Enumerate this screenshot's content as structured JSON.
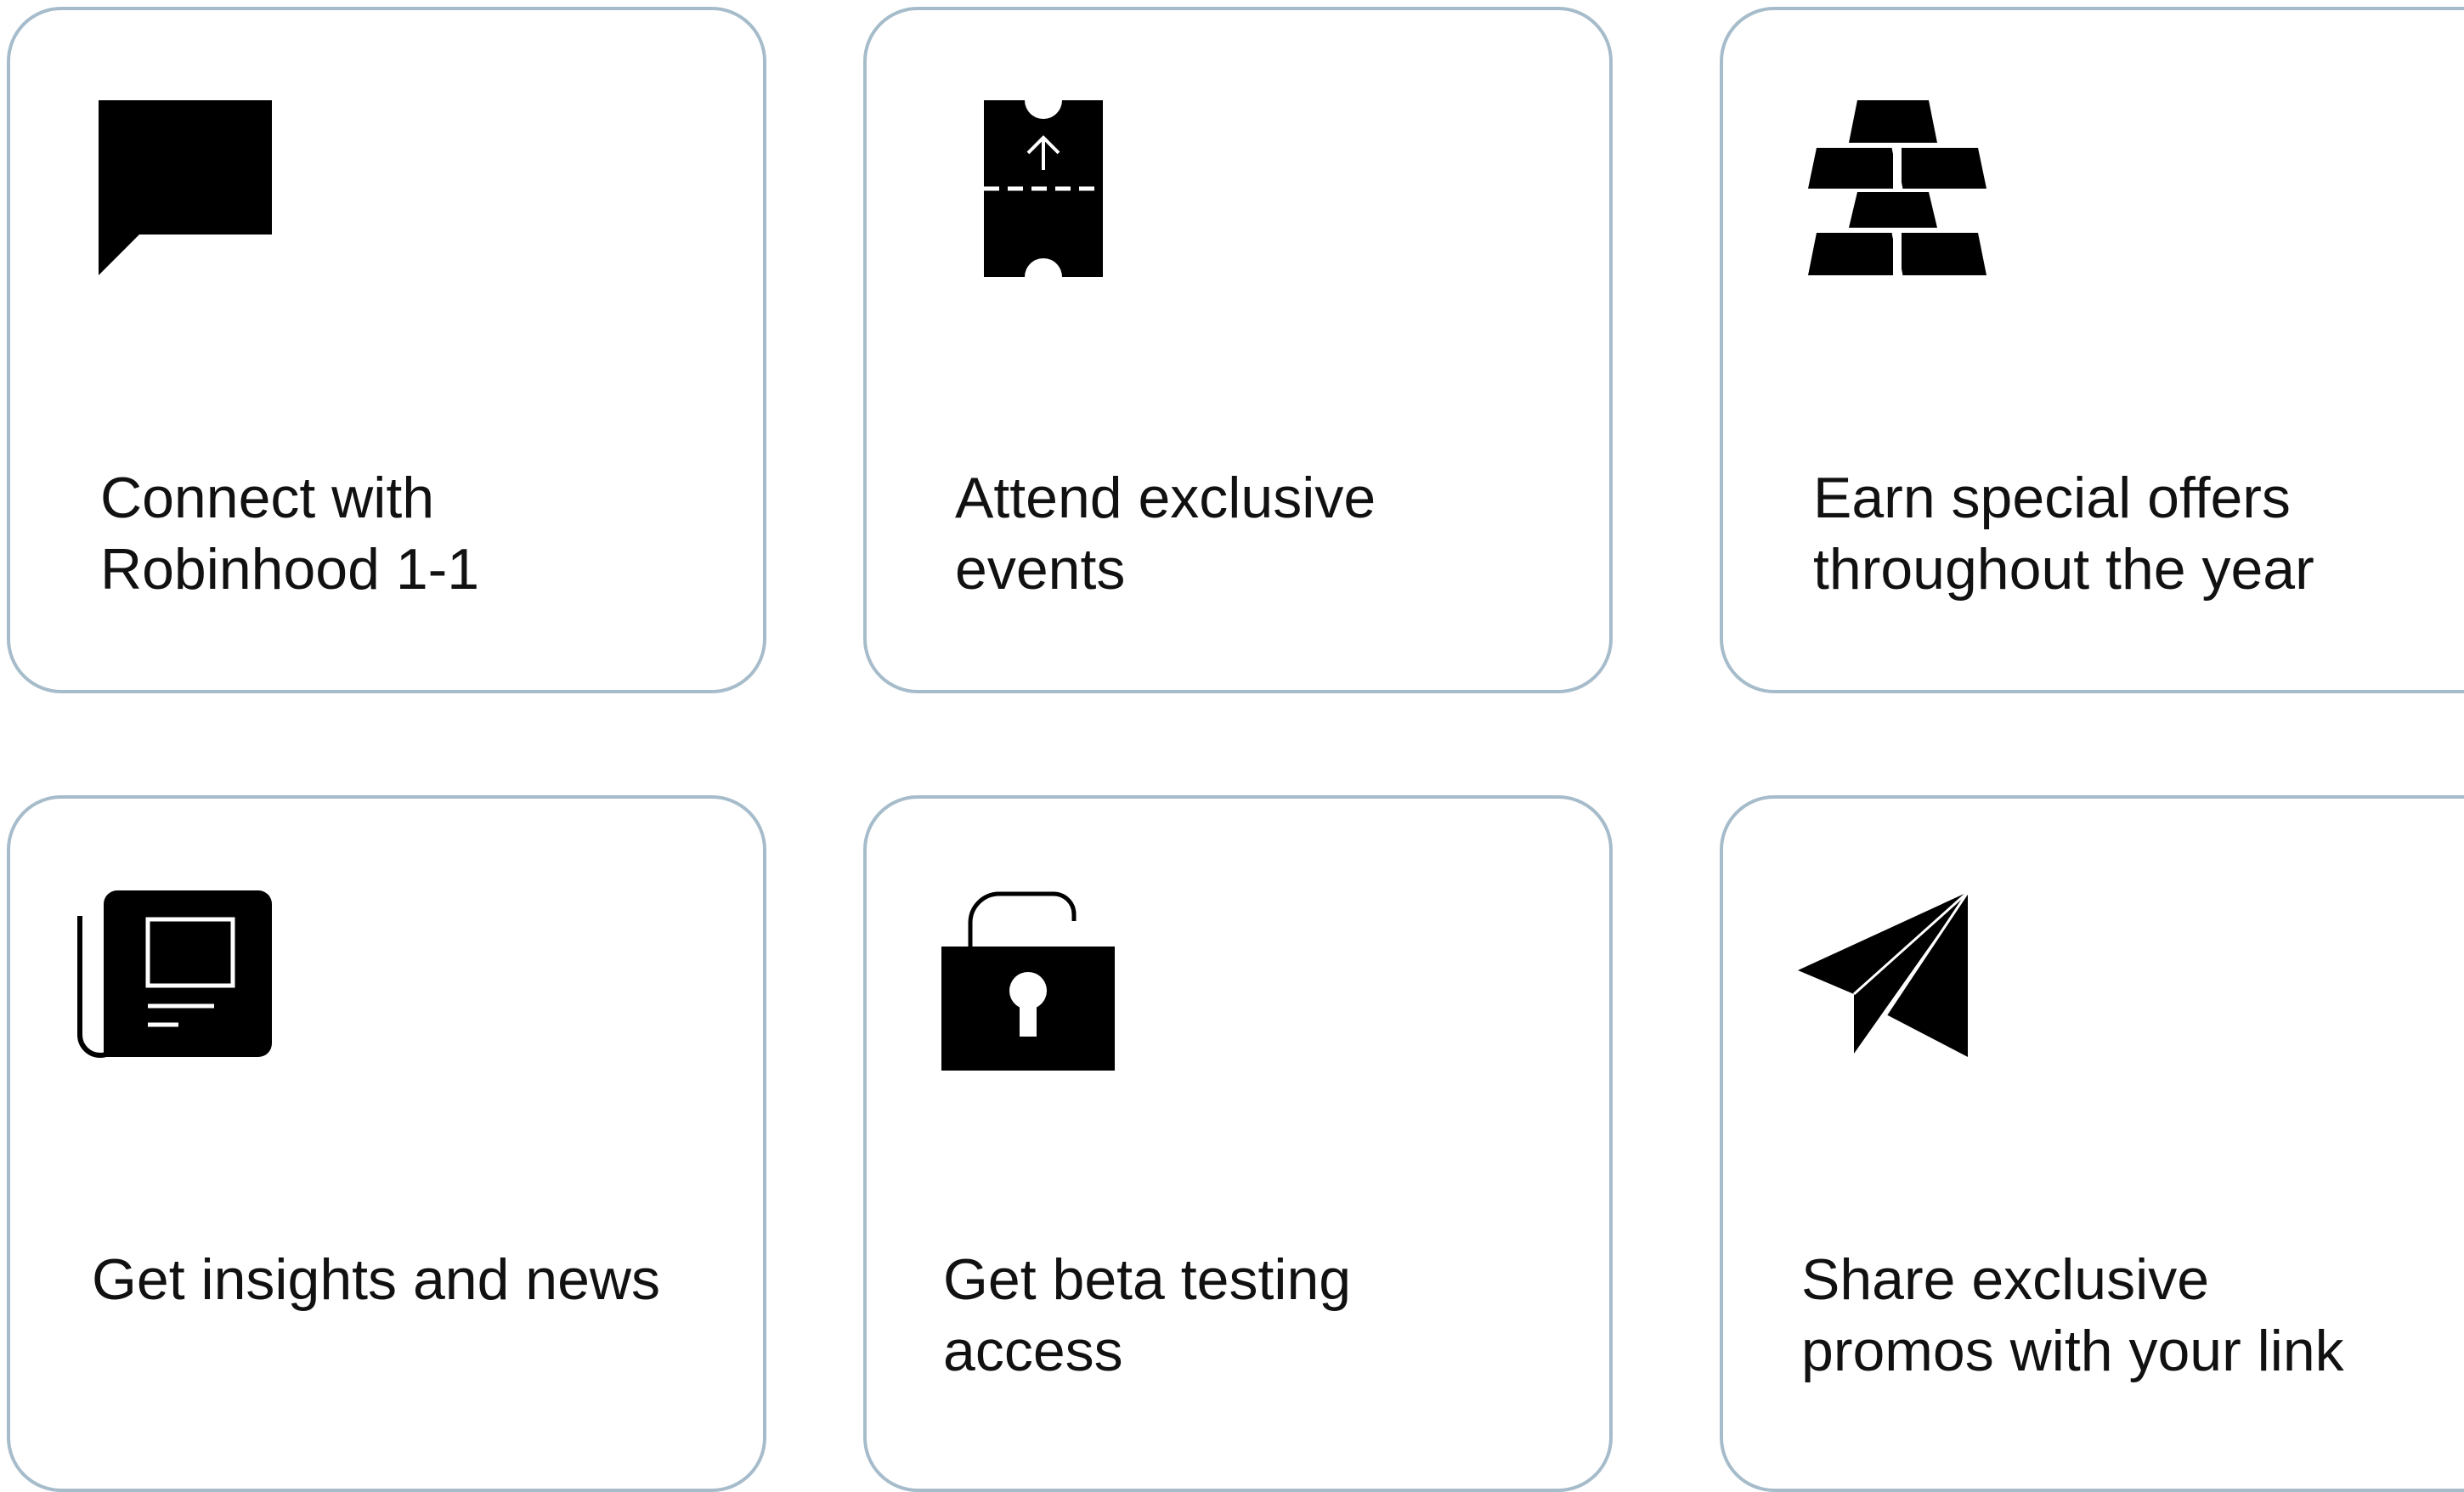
{
  "benefits": [
    {
      "label_line1": "Connect with",
      "label_line2": "Robinhood 1-1",
      "icon": "chat-bubble-icon"
    },
    {
      "label_line1": "Attend exclusive",
      "label_line2": "events",
      "icon": "ticket-icon"
    },
    {
      "label_line1": "Earn special offers",
      "label_line2": "throughout the year",
      "icon": "gold-bars-icon"
    },
    {
      "label_line1": "Get insights and news",
      "label_line2": "",
      "icon": "newspaper-icon"
    },
    {
      "label_line1": "Get beta testing",
      "label_line2": "access",
      "icon": "unlocked-padlock-icon"
    },
    {
      "label_line1": "Share exclusive",
      "label_line2": "promos with your link",
      "icon": "paper-plane-icon"
    }
  ],
  "colors": {
    "card_border": "#a6bccb",
    "icon": "#000000",
    "text": "#111111",
    "background": "#ffffff"
  }
}
